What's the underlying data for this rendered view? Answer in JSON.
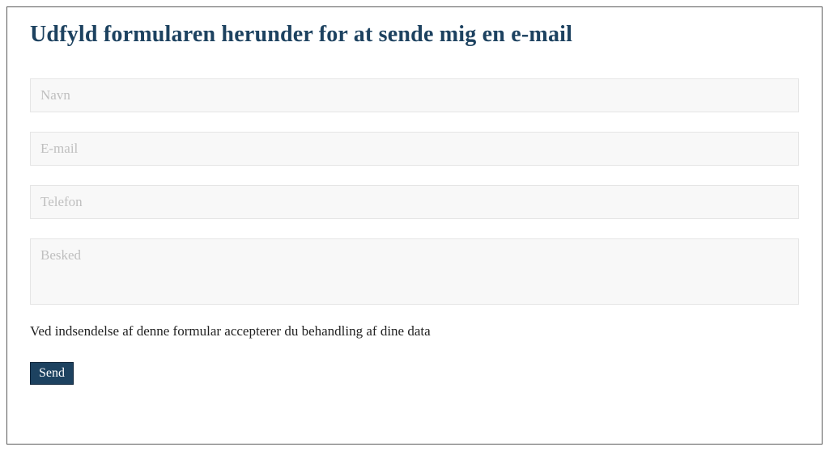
{
  "heading": "Udfyld formularen herunder for at sende mig en e-mail",
  "fields": {
    "name": {
      "placeholder": "Navn",
      "value": ""
    },
    "email": {
      "placeholder": "E-mail",
      "value": ""
    },
    "phone": {
      "placeholder": "Telefon",
      "value": ""
    },
    "message": {
      "placeholder": "Besked",
      "value": ""
    }
  },
  "disclaimer": "Ved indsendelse af denne formular accepterer du behandling af dine data",
  "submit_label": "Send",
  "colors": {
    "accent": "#1d4260",
    "input_bg": "#f8f8f8",
    "input_border": "#e5e5e5",
    "placeholder": "#bfbfbf"
  }
}
